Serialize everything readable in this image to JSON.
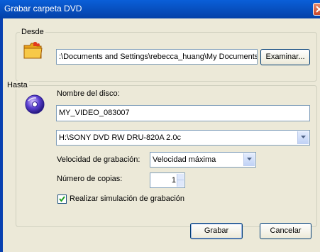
{
  "window": {
    "title": "Grabar carpeta DVD"
  },
  "desde": {
    "label": "Desde",
    "path": ":\\Documents and Settings\\rebecca_huang\\My Documents\\",
    "browse_label": "Examinar..."
  },
  "hasta": {
    "label": "Hasta",
    "disc_name_label": "Nombre del disco:",
    "disc_name_value": "MY_VIDEO_083007",
    "drive_value": "H:\\SONY DVD RW DRU-820A 2.0c",
    "speed_label": "Velocidad de grabación:",
    "speed_value": "Velocidad máxima",
    "copies_label": "Número de copias:",
    "copies_value": "1",
    "simulation_label": "Realizar simulación de grabación",
    "simulation_checked": true
  },
  "footer": {
    "burn_label": "Grabar",
    "cancel_label": "Cancelar"
  }
}
